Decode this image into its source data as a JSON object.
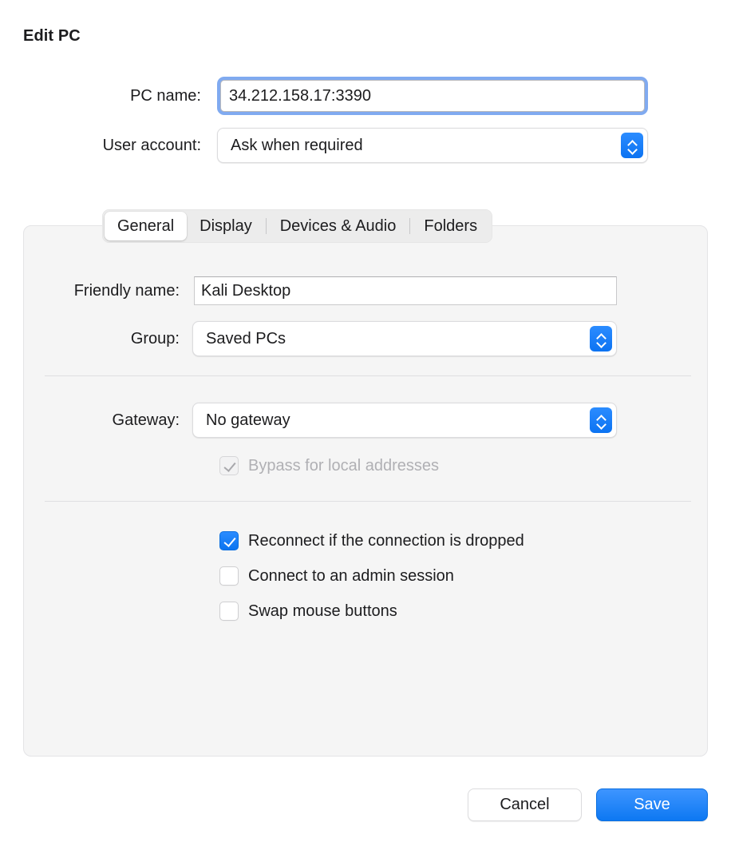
{
  "dialog": {
    "title": "Edit PC"
  },
  "top_form": {
    "pc_name": {
      "label": "PC name:",
      "value": "34.212.158.17:3390",
      "focused": true
    },
    "user_account": {
      "label": "User account:",
      "value": "Ask when required"
    }
  },
  "tabs": [
    {
      "label": "General",
      "selected": true
    },
    {
      "label": "Display",
      "selected": false
    },
    {
      "label": "Devices & Audio",
      "selected": false
    },
    {
      "label": "Folders",
      "selected": false
    }
  ],
  "general_tab": {
    "friendly_name": {
      "label": "Friendly name:",
      "value": "Kali Desktop"
    },
    "group": {
      "label": "Group:",
      "value": "Saved PCs"
    },
    "gateway": {
      "label": "Gateway:",
      "value": "No gateway"
    },
    "checkboxes": [
      {
        "label": "Bypass for local addresses",
        "checked": true,
        "disabled": true
      },
      {
        "label": "Reconnect if the connection is dropped",
        "checked": true,
        "disabled": false
      },
      {
        "label": "Connect to an admin session",
        "checked": false,
        "disabled": false
      },
      {
        "label": "Swap mouse buttons",
        "checked": false,
        "disabled": false
      }
    ]
  },
  "footer": {
    "cancel_label": "Cancel",
    "save_label": "Save"
  },
  "colors": {
    "accent_blue": "#0d78f2",
    "focus_ring": "#80aaf0",
    "panel_bg": "#f5f5f5",
    "divider": "#dfdfe1",
    "text": "#1c1c1e",
    "disabled_text": "#b0b0b4"
  }
}
